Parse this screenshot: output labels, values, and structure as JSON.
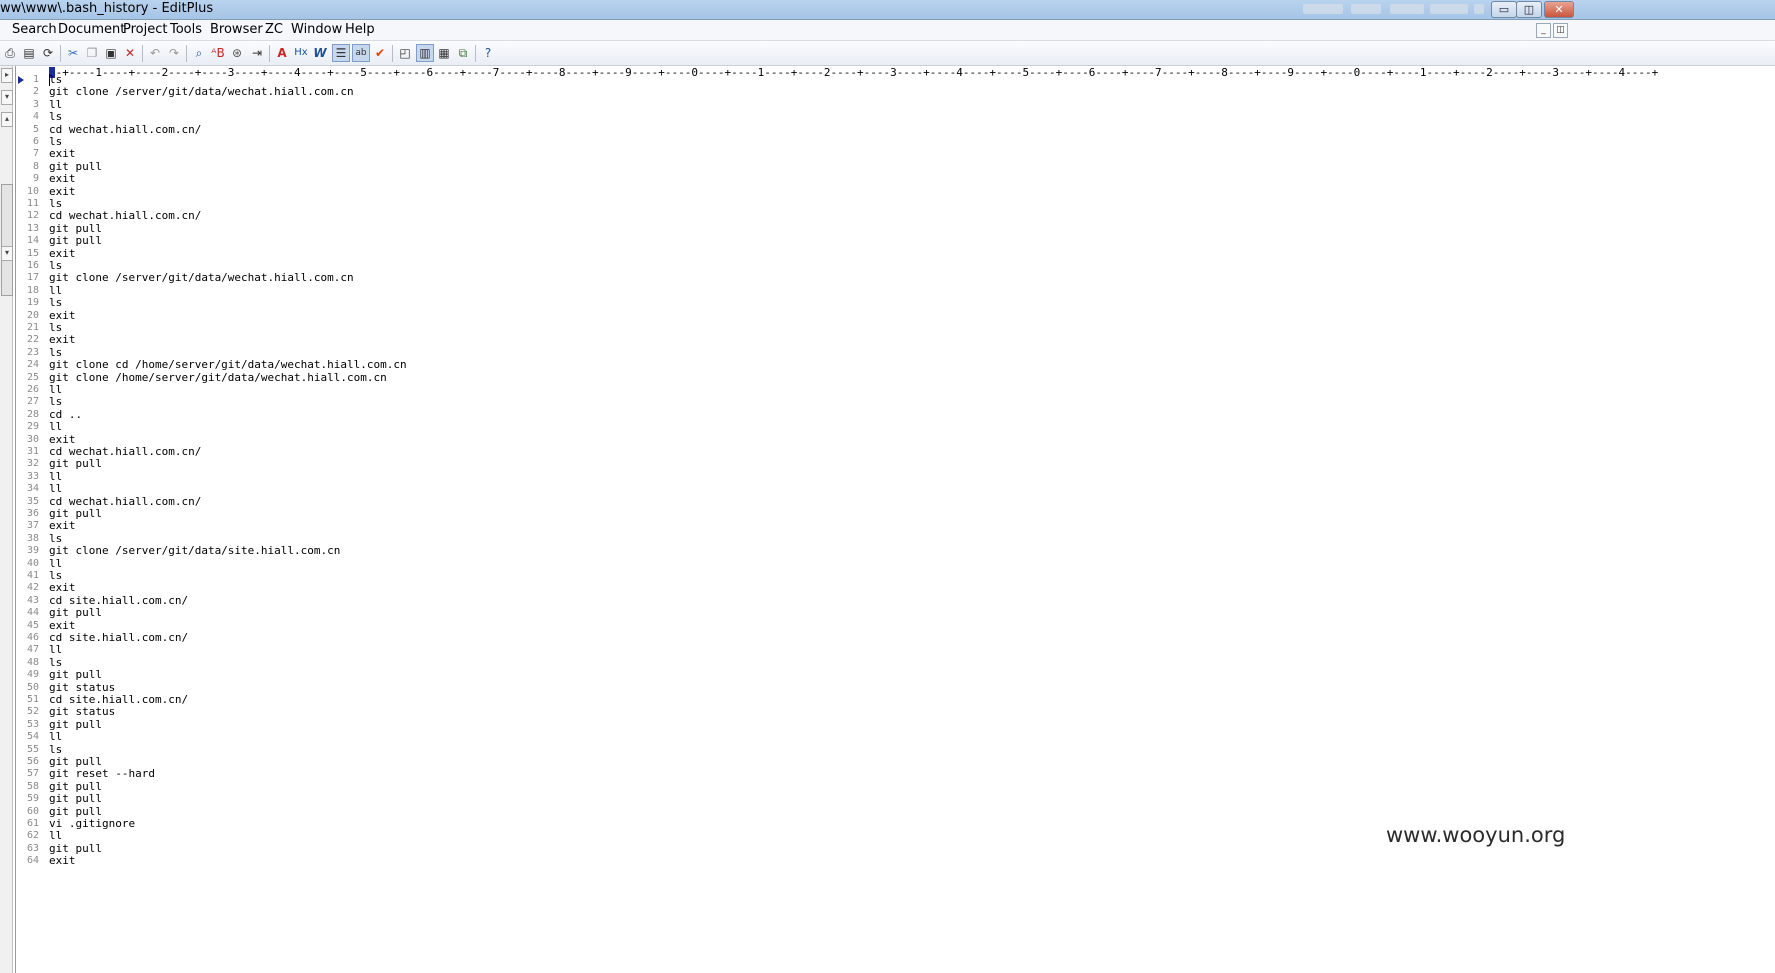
{
  "window": {
    "title": "ww\\www\\.bash_history - EditPlus",
    "controls": {
      "minimize": "▭",
      "maximize": "◫",
      "close": "✕"
    }
  },
  "menu": {
    "items": [
      "Search",
      "Document",
      "Project",
      "Tools",
      "Browser",
      "ZC",
      "Window",
      "Help"
    ],
    "mdi_minimize": "_",
    "mdi_restore": "◫"
  },
  "toolbar": {
    "icons": [
      "print-icon",
      "print-preview-icon",
      "spell-check-icon",
      "cut-icon",
      "copy-icon",
      "paste-icon",
      "delete-icon",
      "undo-icon",
      "redo-icon",
      "find-icon",
      "replace-icon",
      "find-in-files-icon",
      "goto-line-icon",
      "font-icon",
      "hex-icon",
      "word-wrap-icon",
      "line-number-icon",
      "ruler-icon",
      "check-icon",
      "full-screen-icon",
      "output-window-icon",
      "directory-window-icon",
      "cliptext-icon",
      "help-icon"
    ]
  },
  "editor": {
    "ruler": "--+----1----+----2----+----3----+----4----+----5----+----6----+----7----+----8----+----9----+----0----+----1----+----2----+----3----+----4----+----5----+----6----+----7----+----8----+----9----+----0----+----1----+----2----+----3----+----4----+",
    "lines": [
      "ls",
      "git clone /server/git/data/wechat.hiall.com.cn",
      "ll",
      "ls",
      "cd wechat.hiall.com.cn/",
      "ls",
      "exit",
      "git pull",
      "exit",
      "exit",
      "ls",
      "cd wechat.hiall.com.cn/",
      "git pull",
      "git pull",
      "exit",
      "ls",
      "git clone /server/git/data/wechat.hiall.com.cn",
      "ll",
      "ls",
      "exit",
      "ls",
      "exit",
      "ls",
      "git clone cd /home/server/git/data/wechat.hiall.com.cn",
      "git clone /home/server/git/data/wechat.hiall.com.cn",
      "ll",
      "ls",
      "cd ..",
      "ll",
      "exit",
      "cd wechat.hiall.com.cn/",
      "git pull",
      "ll",
      "ll",
      "cd wechat.hiall.com.cn/",
      "git pull",
      "exit",
      "ls",
      "git clone /server/git/data/site.hiall.com.cn",
      "ll",
      "ls",
      "exit",
      "cd site.hiall.com.cn/",
      "git pull",
      "exit",
      "cd site.hiall.com.cn/",
      "ll",
      "ls",
      "git pull",
      "git status",
      "cd site.hiall.com.cn/",
      "git status",
      "git pull",
      "ll",
      "ls",
      "git pull",
      "git reset --hard",
      "git pull",
      "git pull",
      "git pull",
      "vi .gitignore",
      "ll",
      "git pull",
      "exit"
    ]
  },
  "watermark": "www.wooyun.org"
}
